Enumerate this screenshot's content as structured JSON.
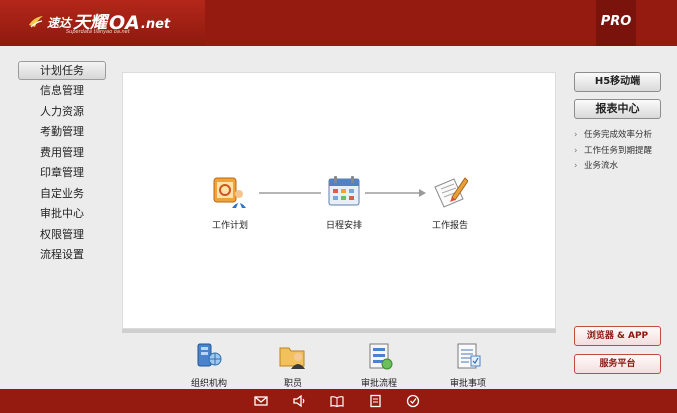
{
  "header": {
    "logo_cn_small": "速达",
    "logo_cn_large": "天耀",
    "logo_oa": "OA",
    "logo_net": ".net",
    "logo_sub": "Superdata tianyao oa.net",
    "edition_badge": "PRO"
  },
  "left_nav": {
    "items": [
      {
        "label": "计划任务",
        "active": true
      },
      {
        "label": "信息管理"
      },
      {
        "label": "人力资源"
      },
      {
        "label": "考勤管理"
      },
      {
        "label": "费用管理"
      },
      {
        "label": "印章管理"
      },
      {
        "label": "自定业务"
      },
      {
        "label": "审批中心"
      },
      {
        "label": "权限管理"
      },
      {
        "label": "流程设置"
      }
    ]
  },
  "workflow": {
    "nodes": [
      {
        "label": "工作计划",
        "icon": "work-plan-icon"
      },
      {
        "label": "日程安排",
        "icon": "calendar-icon"
      },
      {
        "label": "工作报告",
        "icon": "work-report-icon"
      }
    ]
  },
  "bottom_shortcuts": [
    {
      "label": "组织机构",
      "icon": "organization-icon"
    },
    {
      "label": "职员",
      "icon": "staff-folder-icon"
    },
    {
      "label": "审批流程",
      "icon": "approval-flow-icon"
    },
    {
      "label": "审批事项",
      "icon": "approval-items-icon"
    }
  ],
  "right_panel": {
    "mobile_button": "H5移动端",
    "report_button": "报表中心",
    "links": [
      "任务完成效率分析",
      "工作任务到期提醒",
      "业务流水"
    ],
    "browser_button": "浏览器 & APP",
    "service_button": "服务平台"
  },
  "footer": {
    "icons": [
      "mail-icon",
      "speaker-icon",
      "book-icon",
      "document-icon",
      "check-icon"
    ]
  },
  "colors": {
    "brand_red": "#951b10",
    "panel_bg": "#ffffff",
    "page_bg": "#ececec"
  }
}
